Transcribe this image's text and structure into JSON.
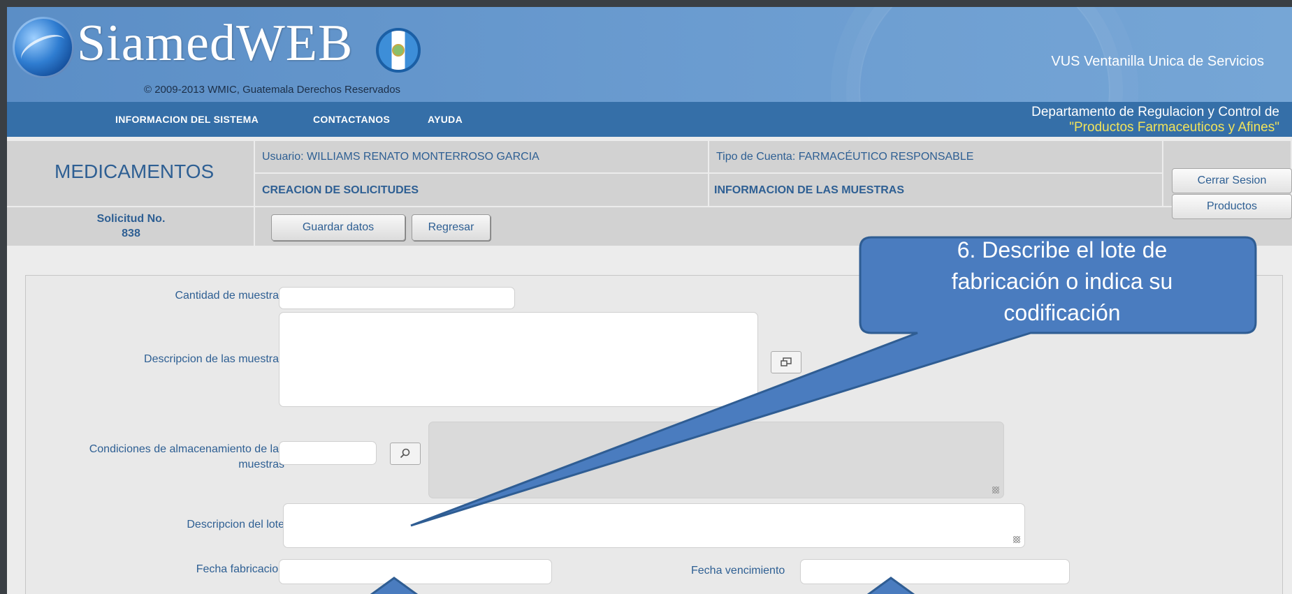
{
  "header": {
    "logo_text": "SiamedWEB",
    "copyright": "© 2009-2013 WMIC, Guatemala Derechos Reservados",
    "vus": "VUS Ventanilla Unica de Servicios"
  },
  "nav": {
    "items": [
      "INFORMACION DEL SISTEMA",
      "CONTACTANOS",
      "AYUDA"
    ],
    "department_line1": "Departamento de Regulacion y Control de",
    "department_line2": "\"Productos Farmaceuticos y Afines\""
  },
  "info": {
    "module": "MEDICAMENTOS",
    "usuario": "Usuario: WILLIAMS RENATO MONTERROSO GARCIA",
    "tipo_cuenta": "Tipo de Cuenta: FARMACÉUTICO RESPONSABLE",
    "creacion": "CREACION DE SOLICITUDES",
    "informacion": "INFORMACION DE LAS MUESTRAS",
    "solicitud_label": "Solicitud No.",
    "solicitud_number": "838"
  },
  "buttons": {
    "guardar": "Guardar datos",
    "regresar": "Regresar",
    "cerrar_sesion": "Cerrar Sesion",
    "productos": "Productos"
  },
  "form": {
    "cantidad_label": "Cantidad de muestras",
    "descripcion_label": "Descripcion de las muestras",
    "condiciones_label_1": "Condiciones de almacenamiento de las",
    "condiciones_label_2": "muestras",
    "lote_label": "Descripcion del lote",
    "fabricacion_label": "Fecha fabricacion",
    "vencimiento_label": "Fecha vencimiento"
  },
  "callout": {
    "line1": "6. Describe el lote de",
    "line2": "fabricación o indica su",
    "line3": "codificación",
    "fill_color": "#4a7cbf",
    "border_color": "#2f5d93"
  },
  "colors": {
    "header_blue": "#5b8ec6",
    "nav_blue": "#356fa8",
    "link_blue": "#2e5f93",
    "department_yellow": "#f2e35a"
  }
}
